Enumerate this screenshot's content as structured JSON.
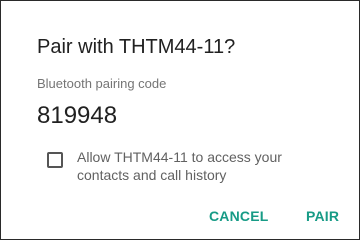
{
  "dialog": {
    "title": "Pair with THTM44-11?",
    "code_label": "Bluetooth pairing code",
    "code": "819948",
    "checkbox": {
      "checked": false,
      "label_line1": "Allow THTM44-11 to access your",
      "label_line2": "contacts and call history"
    },
    "buttons": {
      "cancel": "CANCEL",
      "pair": "PAIR"
    },
    "accent_color": "#179b86"
  }
}
